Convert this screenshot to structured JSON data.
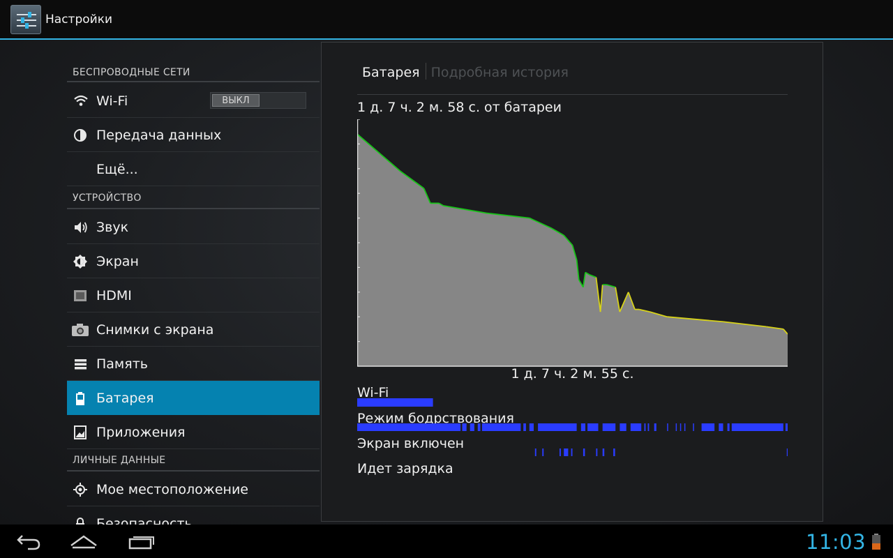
{
  "app": {
    "title": "Настройки",
    "icon": "settings-sliders-icon"
  },
  "settings": {
    "sections": [
      {
        "header": "БЕСПРОВОДНЫЕ СЕТИ"
      },
      {
        "header": "УСТРОЙСТВО"
      },
      {
        "header": "ЛИЧНЫЕ ДАННЫЕ"
      }
    ],
    "items": [
      {
        "label": "Wi-Fi",
        "icon": "wifi-icon"
      },
      {
        "label": "Передача данных",
        "icon": "data-usage-icon"
      },
      {
        "label": "Ещё...",
        "icon": ""
      },
      {
        "label": "Звук",
        "icon": "speaker-icon"
      },
      {
        "label": "Экран",
        "icon": "brightness-icon"
      },
      {
        "label": "HDMI",
        "icon": "hdmi-icon"
      },
      {
        "label": "Снимки с экрана",
        "icon": "camera-icon"
      },
      {
        "label": "Память",
        "icon": "storage-icon"
      },
      {
        "label": "Батарея",
        "icon": "battery-icon",
        "selected": true
      },
      {
        "label": "Приложения",
        "icon": "apps-icon"
      },
      {
        "label": "Мое местоположение",
        "icon": "location-icon"
      },
      {
        "label": "Безопасность",
        "icon": "lock-icon"
      }
    ],
    "wifi_toggle": {
      "state_label": "ВЫКЛ",
      "on": false
    }
  },
  "battery_panel": {
    "tabs": {
      "active": "Батарея",
      "inactive": "Подробная история"
    },
    "on_battery_text": "1 д. 7 ч. 2 м. 58 с. от батареи",
    "duration_label": "1 д. 7 ч. 2 м. 55 с.",
    "tracks": [
      {
        "label": "Wi-Fi"
      },
      {
        "label": "Режим бодрствования"
      },
      {
        "label": "Экран включен"
      },
      {
        "label": "Идет зарядка"
      }
    ]
  },
  "chart_data": {
    "type": "area",
    "x_unit": "fraction of elapsed time",
    "y_unit": "battery level (fraction)",
    "ylim": [
      0,
      1
    ],
    "x": [
      0,
      0.1,
      0.155,
      0.165,
      0.17,
      0.19,
      0.2,
      0.3,
      0.35,
      0.4,
      0.45,
      0.47,
      0.48,
      0.5,
      0.51,
      0.515,
      0.525,
      0.53,
      0.54,
      0.555,
      0.565,
      0.57,
      0.58,
      0.6,
      0.61,
      0.625,
      0.63,
      0.645,
      0.655,
      0.68,
      0.72,
      0.85,
      0.95,
      0.99,
      1.0
    ],
    "y": [
      0.94,
      0.79,
      0.72,
      0.68,
      0.66,
      0.66,
      0.65,
      0.62,
      0.61,
      0.6,
      0.56,
      0.54,
      0.53,
      0.49,
      0.43,
      0.35,
      0.32,
      0.38,
      0.37,
      0.36,
      0.22,
      0.33,
      0.33,
      0.32,
      0.22,
      0.28,
      0.3,
      0.23,
      0.23,
      0.22,
      0.2,
      0.18,
      0.16,
      0.15,
      0.13
    ],
    "series_colors": {
      "high": "#18c418",
      "medium": "#d7d21a",
      "low": "#e03a1a"
    },
    "fill_color": "#868686"
  },
  "tracks_data": {
    "wifi": [
      [
        0,
        0.176
      ]
    ],
    "awake": [
      [
        0,
        0.24
      ],
      [
        0.244,
        0.254
      ],
      [
        0.262,
        0.272
      ],
      [
        0.28,
        0.286
      ],
      [
        0.29,
        0.38
      ],
      [
        0.386,
        0.392
      ],
      [
        0.4,
        0.41
      ],
      [
        0.42,
        0.51
      ],
      [
        0.52,
        0.53
      ],
      [
        0.535,
        0.56
      ],
      [
        0.57,
        0.6
      ],
      [
        0.61,
        0.625
      ],
      [
        0.635,
        0.66
      ],
      [
        0.667,
        0.67
      ],
      [
        0.675,
        0.678
      ],
      [
        0.69,
        0.695
      ],
      [
        0.72,
        0.722
      ],
      [
        0.74,
        0.742
      ],
      [
        0.75,
        0.752
      ],
      [
        0.76,
        0.762
      ],
      [
        0.78,
        0.782
      ],
      [
        0.8,
        0.83
      ],
      [
        0.84,
        0.85
      ],
      [
        0.86,
        0.865
      ],
      [
        0.87,
        0.99
      ],
      [
        0.995,
        1.0
      ]
    ],
    "screen": [
      [
        0.413,
        0.416
      ],
      [
        0.43,
        0.433
      ],
      [
        0.47,
        0.473
      ],
      [
        0.48,
        0.49
      ],
      [
        0.497,
        0.5
      ],
      [
        0.525,
        0.529
      ],
      [
        0.555,
        0.558
      ],
      [
        0.57,
        0.574
      ],
      [
        0.595,
        0.599
      ],
      [
        0.998,
        1.0
      ]
    ],
    "charging": []
  },
  "status_bar": {
    "time": "11:03",
    "track_colors": {
      "bar": "#2a3cff",
      "screen": "#2a3cff"
    }
  }
}
